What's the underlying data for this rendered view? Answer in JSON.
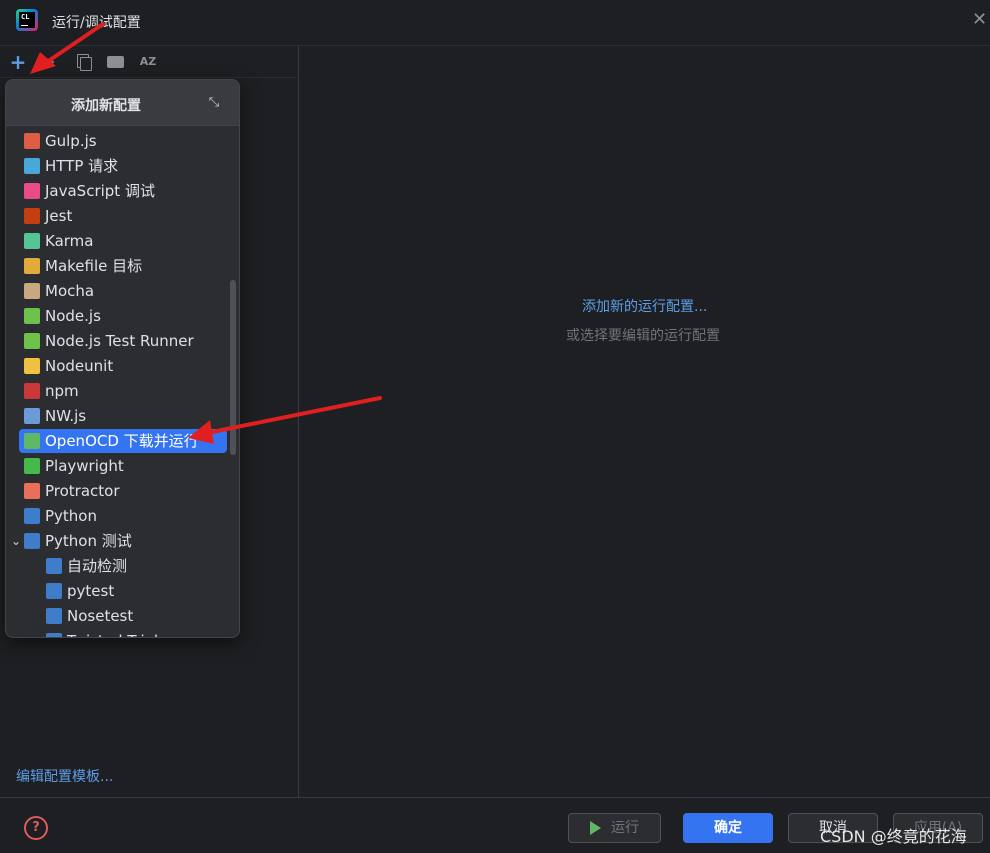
{
  "window": {
    "title": "运行/调试配置"
  },
  "toolbar": {
    "sort_label": "AZ"
  },
  "popup": {
    "title": "添加新配置",
    "items": [
      {
        "label": "Gulp.js",
        "icon": "gulp-icon",
        "color": "#e05d44"
      },
      {
        "label": "HTTP 请求",
        "icon": "api-icon",
        "color": "#4aa8d8"
      },
      {
        "label": "JavaScript 调试",
        "icon": "js-debug-icon",
        "color": "#e84d8a"
      },
      {
        "label": "Jest",
        "icon": "jest-icon",
        "color": "#c63d14"
      },
      {
        "label": "Karma",
        "icon": "karma-icon",
        "color": "#56c596"
      },
      {
        "label": "Makefile 目标",
        "icon": "makefile-icon",
        "color": "#e2a93b"
      },
      {
        "label": "Mocha",
        "icon": "mocha-icon",
        "color": "#c8a97e"
      },
      {
        "label": "Node.js",
        "icon": "nodejs-icon",
        "color": "#6cc24a"
      },
      {
        "label": "Node.js Test Runner",
        "icon": "nodejs-test-icon",
        "color": "#6cc24a"
      },
      {
        "label": "Nodeunit",
        "icon": "nodeunit-icon",
        "color": "#f0c040"
      },
      {
        "label": "npm",
        "icon": "npm-icon",
        "color": "#cb3837"
      },
      {
        "label": "NW.js",
        "icon": "nwjs-icon",
        "color": "#6b9bd6"
      },
      {
        "label": "OpenOCD 下载并运行",
        "icon": "openocd-icon",
        "color": "#5fb865",
        "selected": true
      },
      {
        "label": "Playwright",
        "icon": "playwright-icon",
        "color": "#45ba4b"
      },
      {
        "label": "Protractor",
        "icon": "protractor-icon",
        "color": "#e8705a"
      },
      {
        "label": "Python",
        "icon": "python-icon",
        "color": "#3f7cc9"
      },
      {
        "label": "Python 测试",
        "icon": "python-test-icon",
        "color": "#3f7cc9",
        "expanded": true
      },
      {
        "label": "自动检测",
        "icon": "python-test-icon",
        "color": "#3f7cc9",
        "child": true
      },
      {
        "label": "pytest",
        "icon": "python-test-icon",
        "color": "#3f7cc9",
        "child": true
      },
      {
        "label": "Nosetest",
        "icon": "python-test-icon",
        "color": "#3f7cc9",
        "child": true
      },
      {
        "label": "Twisted Trial",
        "icon": "python-test-icon",
        "color": "#3f7cc9",
        "child": true
      }
    ]
  },
  "left": {
    "edit_templates": "编辑配置模板..."
  },
  "right": {
    "add_new": "添加新的运行配置...",
    "or_select": "或选择要编辑的运行配置"
  },
  "footer": {
    "help": "?",
    "run": "运行",
    "ok": "确定",
    "cancel": "取消",
    "apply": "应用(A)"
  },
  "watermark": "CSDN @终竟的花海",
  "colors": {
    "accent": "#3574f0",
    "link": "#5d9ce8",
    "arrow": "#e02020"
  }
}
